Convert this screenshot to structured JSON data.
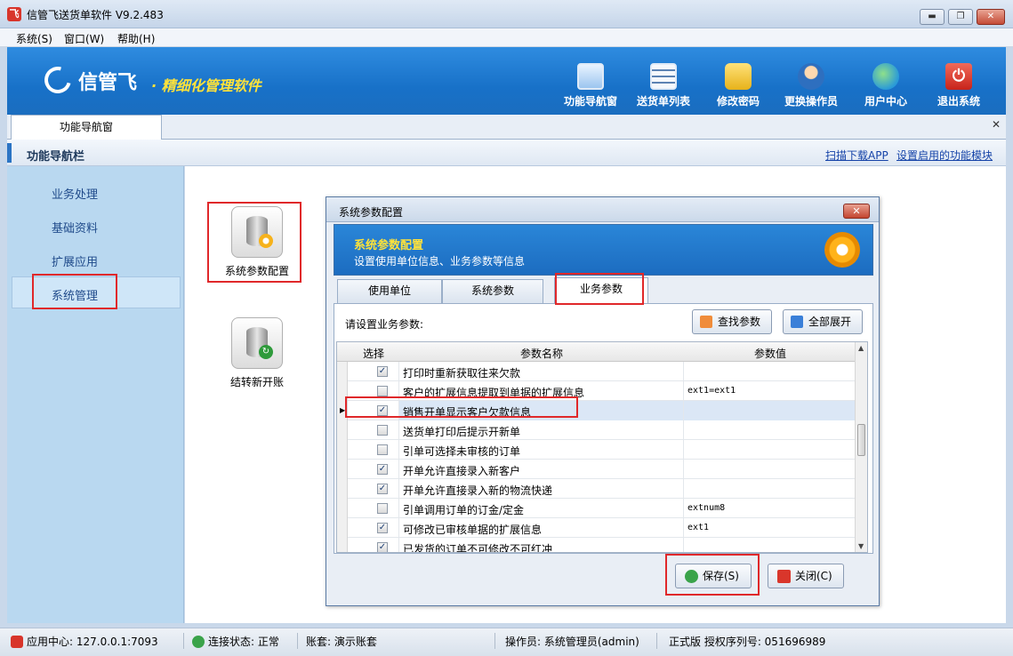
{
  "window": {
    "title": "信管飞送货单软件 V9.2.483",
    "controls": [
      "▬",
      "❐",
      "✕"
    ]
  },
  "menu": [
    "系统(S)",
    "窗口(W)",
    "帮助(H)"
  ],
  "banner": {
    "brand": "信管飞",
    "slogan": "· 精细化管理软件",
    "tools": [
      {
        "label": "功能导航窗",
        "icon": "monitor-icon"
      },
      {
        "label": "送货单列表",
        "icon": "list-icon"
      },
      {
        "label": "修改密码",
        "icon": "lock-icon"
      },
      {
        "label": "更换操作员",
        "icon": "user-icon"
      },
      {
        "label": "用户中心",
        "icon": "globe-icon"
      },
      {
        "label": "退出系统",
        "icon": "power-icon"
      }
    ]
  },
  "tabs": {
    "nav": "功能导航窗",
    "close": "✕"
  },
  "navbar": {
    "title": "功能导航栏",
    "links": [
      "扫描下载APP",
      "设置启用的功能模块"
    ]
  },
  "sidebar": {
    "items": [
      "业务处理",
      "基础资料",
      "扩展应用",
      "系统管理"
    ],
    "active": "系统管理"
  },
  "functions": [
    {
      "label": "系统参数配置",
      "icon": "database-gear-icon"
    },
    {
      "label": "结转新开账",
      "icon": "database-refresh-icon"
    }
  ],
  "dialog": {
    "title": "系统参数配置",
    "close": "✕",
    "header_title": "系统参数配置",
    "header_sub": "设置使用单位信息、业务参数等信息",
    "tabs": [
      "使用单位",
      "系统参数",
      "业务参数"
    ],
    "active_tab": "业务参数",
    "panel_label": "请设置业务参数:",
    "btn_search": "查找参数",
    "btn_expand": "全部展开",
    "columns": [
      "选择",
      "参数名称",
      "参数值"
    ],
    "rows": [
      {
        "checked": "✓",
        "name": "打印时重新获取往来欠款",
        "value": ""
      },
      {
        "checked": "",
        "name": "客户的扩展信息提取到单据的扩展信息",
        "value": "ext1=ext1"
      },
      {
        "checked": "✓",
        "name": "销售开单显示客户欠款信息",
        "value": "",
        "selected": true
      },
      {
        "checked": "",
        "name": "送货单打印后提示开新单",
        "value": ""
      },
      {
        "checked": "",
        "name": "引单可选择未审核的订单",
        "value": ""
      },
      {
        "checked": "✓",
        "name": "开单允许直接录入新客户",
        "value": ""
      },
      {
        "checked": "✓",
        "name": "开单允许直接录入新的物流快递",
        "value": ""
      },
      {
        "checked": "",
        "name": "引单调用订单的订金/定金",
        "value": "extnum8"
      },
      {
        "checked": "✓",
        "name": "可修改已审核单据的扩展信息",
        "value": "ext1"
      },
      {
        "checked": "✓",
        "name": "已发货的订单不可修改不可红冲",
        "value": ""
      }
    ],
    "btn_save": "保存(S)",
    "btn_close": "关闭(C)"
  },
  "status": {
    "app_center": "应用中心: 127.0.0.1:7093",
    "connection": "连接状态: 正常",
    "account": "账套: 演示账套",
    "operator": "操作员: 系统管理员(admin)",
    "license": "正式版 授权序列号: 051696989"
  }
}
